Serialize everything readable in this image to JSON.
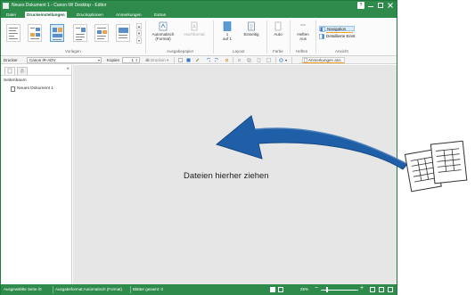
{
  "window": {
    "title": "Neues Dokument 1 - Canon iW Desktop - Editor",
    "help_glyph": "?"
  },
  "tabs": [
    "Datei",
    "Druckeinstellungen",
    "Druckoptionen",
    "Anmerkungen",
    "Extras"
  ],
  "ribbon": {
    "groups": {
      "vorlagen": "Vorlagen",
      "ausgabepapier": "Ausgabepapier",
      "layout": "Layout",
      "farbe": "Farbe",
      "heften": "Heften",
      "ansicht": "Ansicht"
    },
    "ausgabepapier": {
      "auto_line1": "Automatisch",
      "auto_line2": "(Format)",
      "hochformat": "Hochformat"
    },
    "layout": {
      "pages_line1": "1",
      "pages_line2": "auf 1",
      "einseitig": "Einseitig"
    },
    "farbe": {
      "auto": "Auto"
    },
    "heften": {
      "label": "Heften",
      "value": "Aus"
    },
    "ansicht": {
      "navigation": "Navigation",
      "detailed": "Detaillierte Einst"
    }
  },
  "toolbar": {
    "drucker_label": "Drucker",
    "drucker_value": "Canon iR-ADV",
    "kopien_label": "Kopien",
    "kopien_value": "1",
    "drucken_label": "Drucken",
    "anmerkungen_label": "Anmerkungen anz."
  },
  "sidepanel": {
    "title": "Seitenbaum",
    "items": [
      "Neues Dokument 1"
    ]
  },
  "main": {
    "drop_text": "Dateien hierher ziehen"
  },
  "statusbar": {
    "selected": "Ausgewählte Serie /0",
    "paper": "Ausgabeformat:Automatisch (Format)",
    "sheets": "Blätter gesamt: 0",
    "zoom": "25%",
    "zoom_minus": "−",
    "zoom_plus": "+"
  },
  "colors": {
    "brand_green": "#2e8b4b",
    "arrow_blue": "#1f5fa8",
    "accent_orange": "#f0a020"
  }
}
